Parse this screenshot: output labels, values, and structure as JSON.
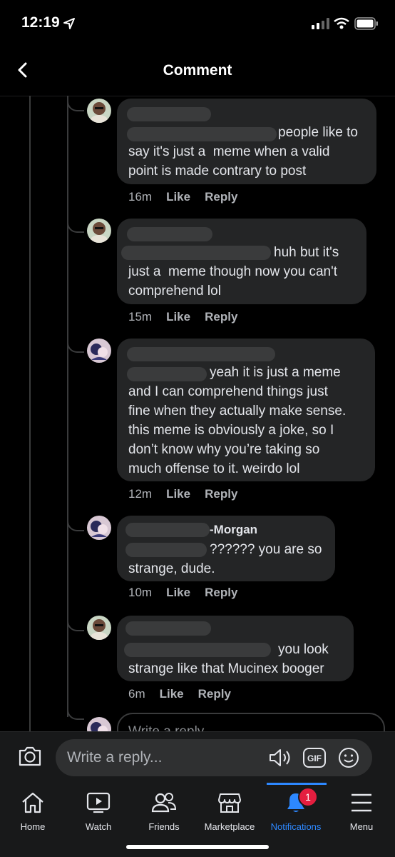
{
  "status": {
    "time": "12:19"
  },
  "header": {
    "title": "Comment"
  },
  "comments": [
    {
      "name": "",
      "text": "people like to\nsay it's just a  meme when a valid\npoint is made contrary to post",
      "time": "16m",
      "like": "Like",
      "reply": "Reply"
    },
    {
      "name": "",
      "text": "huh but it's\njust a  meme though now you can't\ncomprehend lol",
      "time": "15m",
      "like": "Like",
      "reply": "Reply"
    },
    {
      "name": "",
      "text": "yeah it is just a meme\nand I can comprehend things just\nfine when they actually make sense.\nthis meme is obviously a joke, so I\ndon’t know why you’re taking so\nmuch offense to it. weirdo lol",
      "time": "12m",
      "like": "Like",
      "reply": "Reply"
    },
    {
      "name": "-Morgan",
      "text": "?????? you are so\nstrange, dude.",
      "time": "10m",
      "like": "Like",
      "reply": "Reply"
    },
    {
      "name": "",
      "text": "you look\nstrange like that Mucinex booger",
      "time": "6m",
      "like": "Like",
      "reply": "Reply"
    }
  ],
  "inline_reply": {
    "placeholder": "Write a reply"
  },
  "composer": {
    "placeholder": "Write a reply..."
  },
  "tabs": [
    {
      "label": "Home",
      "icon": "home-icon"
    },
    {
      "label": "Watch",
      "icon": "watch-icon"
    },
    {
      "label": "Friends",
      "icon": "friends-icon"
    },
    {
      "label": "Marketplace",
      "icon": "marketplace-icon"
    },
    {
      "label": "Notifications",
      "icon": "bell-icon",
      "badge": "1"
    },
    {
      "label": "Menu",
      "icon": "menu-icon"
    }
  ],
  "colors": {
    "accent": "#2d88ff",
    "badge": "#e41e3f",
    "bubble": "#242526"
  }
}
